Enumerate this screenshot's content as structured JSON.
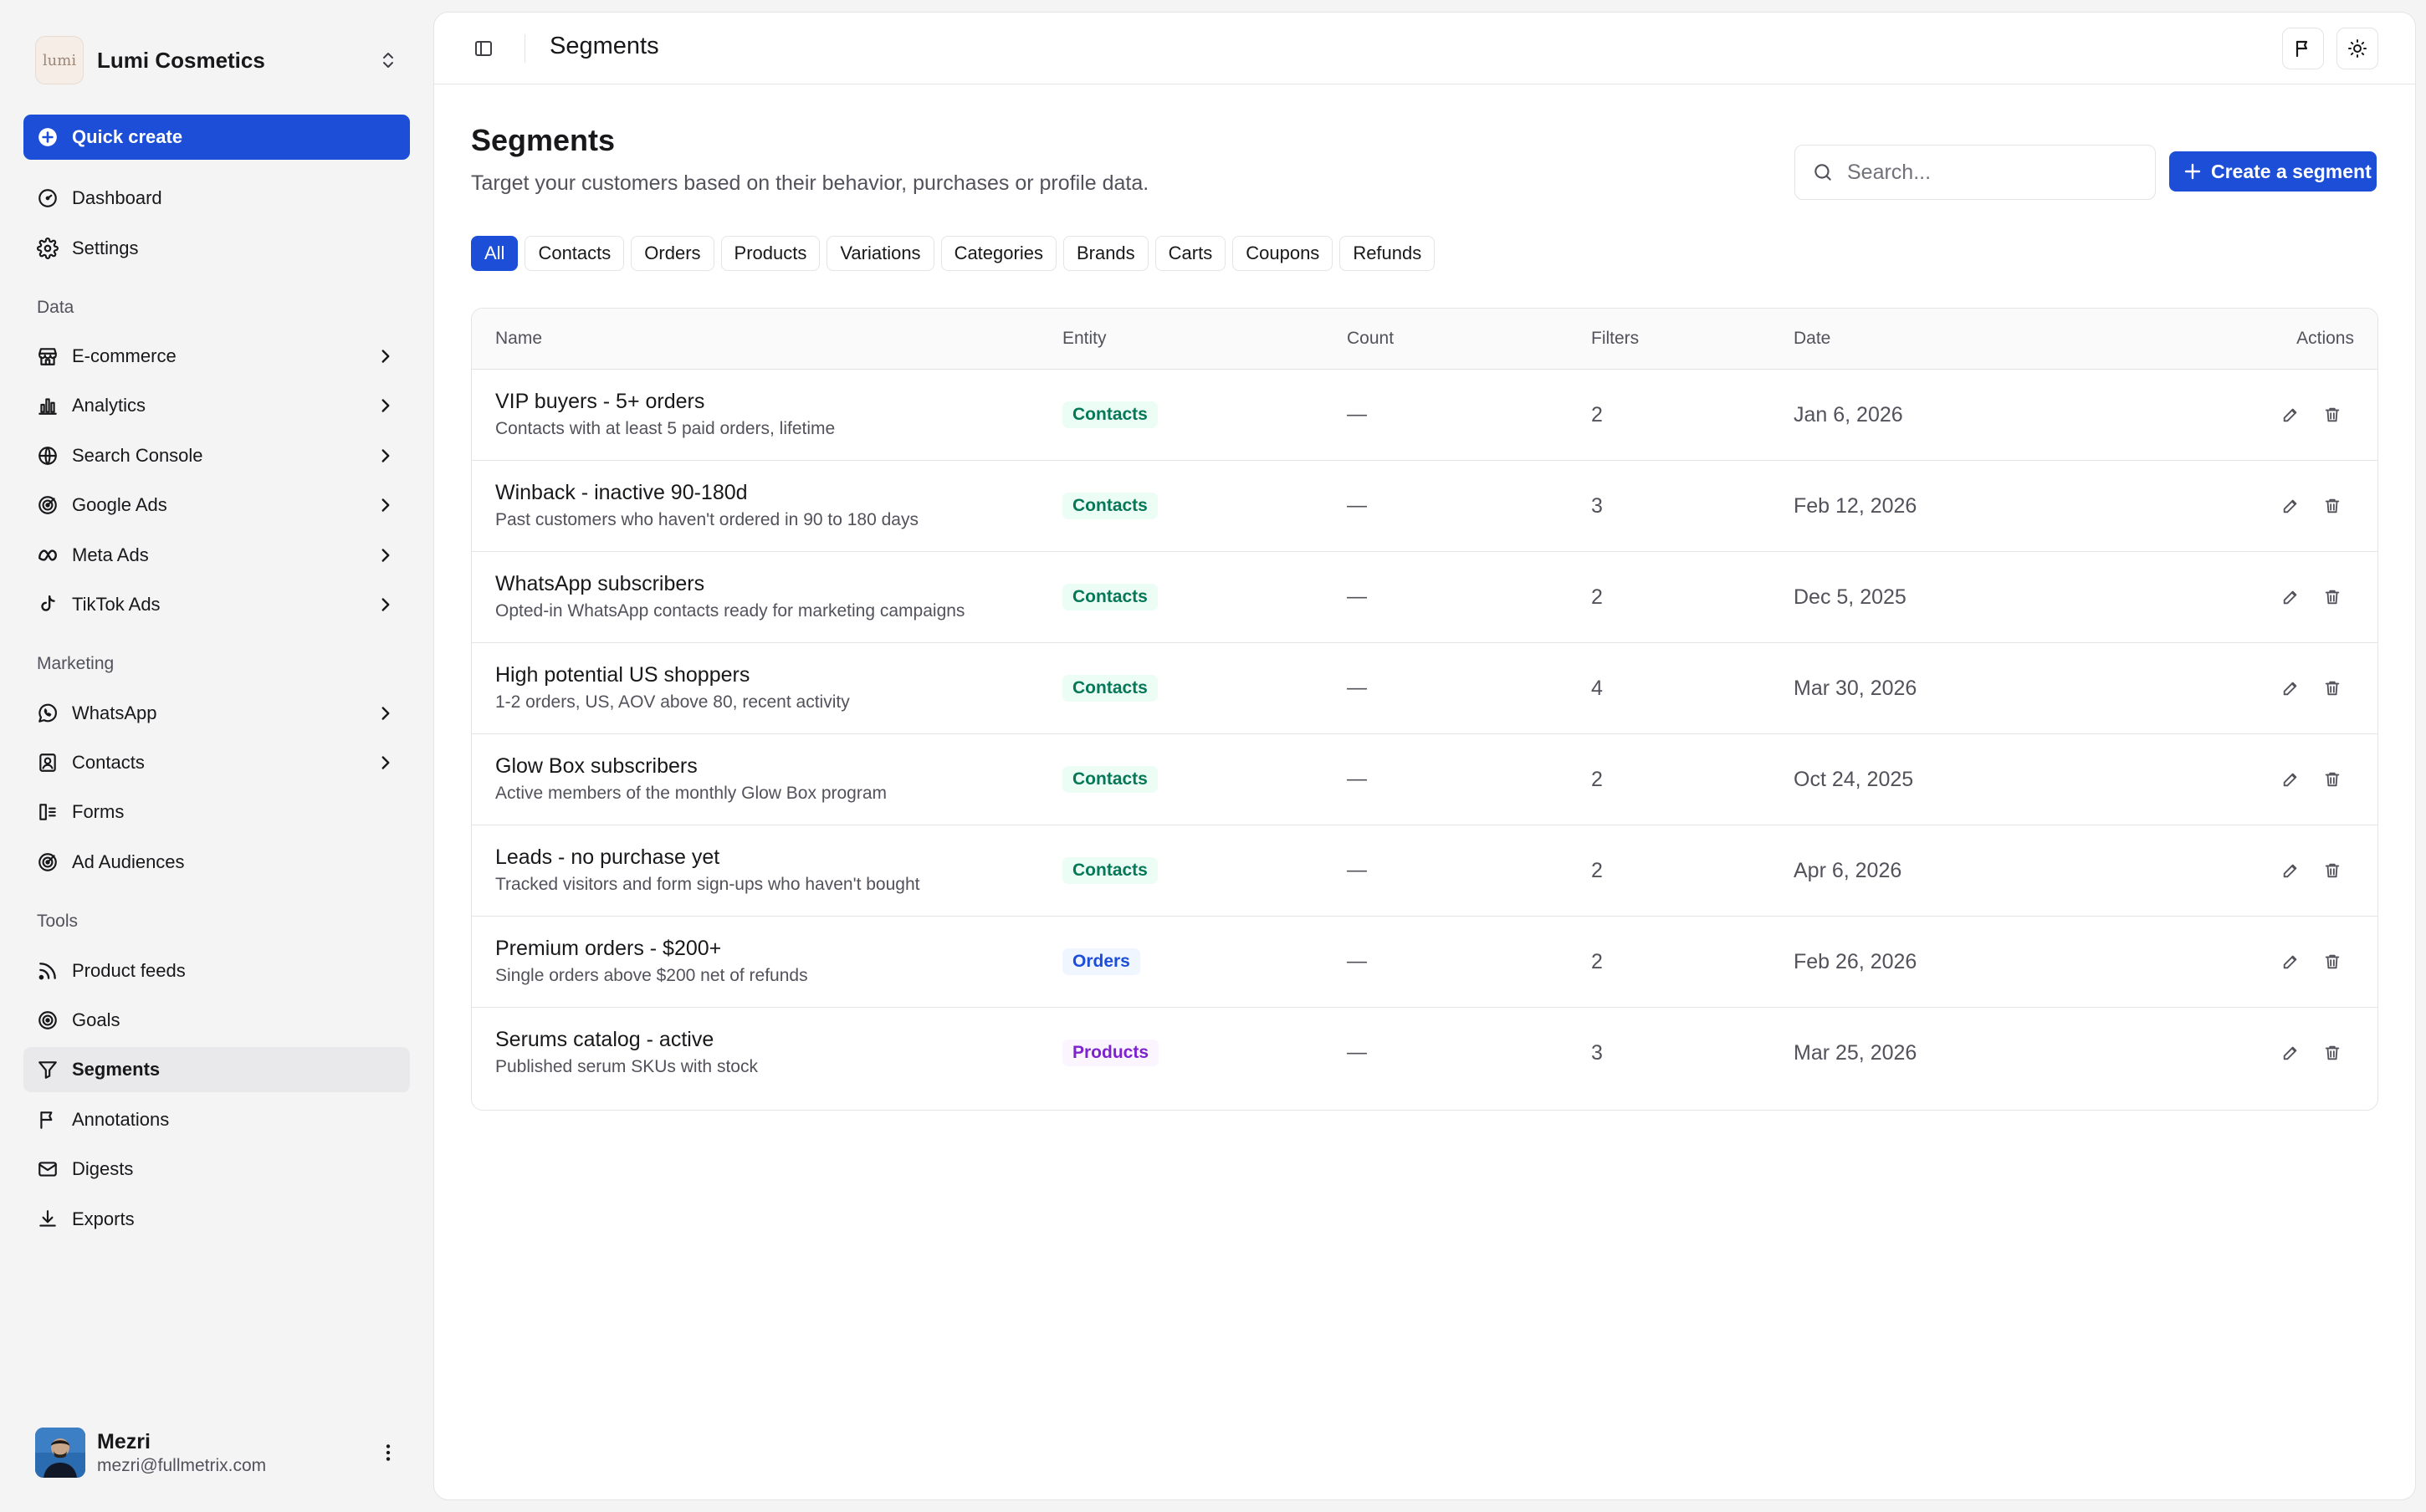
{
  "brand": {
    "logo_text": "lumi",
    "name": "Lumi Cosmetics"
  },
  "sidebar": {
    "quick_create": "Quick create",
    "top_items": [
      {
        "label": "Dashboard",
        "icon": "dashboard-icon"
      },
      {
        "label": "Settings",
        "icon": "gear-icon"
      }
    ],
    "sections": {
      "data": "Data",
      "marketing": "Marketing",
      "tools": "Tools"
    },
    "data_items": [
      {
        "label": "E-commerce",
        "icon": "store-icon"
      },
      {
        "label": "Analytics",
        "icon": "bar-chart-icon"
      },
      {
        "label": "Search Console",
        "icon": "search-console-icon"
      },
      {
        "label": "Google Ads",
        "icon": "google-ads-icon"
      },
      {
        "label": "Meta Ads",
        "icon": "meta-icon"
      },
      {
        "label": "TikTok Ads",
        "icon": "tiktok-icon"
      }
    ],
    "marketing_items": [
      {
        "label": "WhatsApp",
        "icon": "whatsapp-icon"
      },
      {
        "label": "Contacts",
        "icon": "contacts-icon"
      },
      {
        "label": "Forms",
        "icon": "forms-icon"
      },
      {
        "label": "Ad Audiences",
        "icon": "target-icon"
      }
    ],
    "tools_items": [
      {
        "label": "Product feeds",
        "icon": "rss-icon"
      },
      {
        "label": "Goals",
        "icon": "goal-icon"
      },
      {
        "label": "Segments",
        "icon": "filter-icon"
      },
      {
        "label": "Annotations",
        "icon": "flag-icon"
      },
      {
        "label": "Digests",
        "icon": "mail-icon"
      },
      {
        "label": "Exports",
        "icon": "download-icon"
      }
    ]
  },
  "user": {
    "name": "Mezri",
    "email": "mezri@fullmetrix.com"
  },
  "topbar": {
    "title": "Segments"
  },
  "page": {
    "title": "Segments",
    "subtitle": "Target your customers based on their behavior, purchases or profile data.",
    "search_placeholder": "Search...",
    "create_label": "Create a segment"
  },
  "tabs": [
    "All",
    "Contacts",
    "Orders",
    "Products",
    "Variations",
    "Categories",
    "Brands",
    "Carts",
    "Coupons",
    "Refunds"
  ],
  "table": {
    "headers": {
      "name": "Name",
      "entity": "Entity",
      "count": "Count",
      "filters": "Filters",
      "date": "Date",
      "actions": "Actions"
    },
    "rows": [
      {
        "title": "VIP buyers - 5+ orders",
        "desc": "Contacts with at least 5 paid orders, lifetime",
        "entity": "Contacts",
        "count": "—",
        "filters": "2",
        "date": "Jan 6, 2026"
      },
      {
        "title": "Winback - inactive 90-180d",
        "desc": "Past customers who haven't ordered in 90 to 180 days",
        "entity": "Contacts",
        "count": "—",
        "filters": "3",
        "date": "Feb 12, 2026"
      },
      {
        "title": "WhatsApp subscribers",
        "desc": "Opted-in WhatsApp contacts ready for marketing campaigns",
        "entity": "Contacts",
        "count": "—",
        "filters": "2",
        "date": "Dec 5, 2025"
      },
      {
        "title": "High potential US shoppers",
        "desc": "1-2 orders, US, AOV above 80, recent activity",
        "entity": "Contacts",
        "count": "—",
        "filters": "4",
        "date": "Mar 30, 2026"
      },
      {
        "title": "Glow Box subscribers",
        "desc": "Active members of the monthly Glow Box program",
        "entity": "Contacts",
        "count": "—",
        "filters": "2",
        "date": "Oct 24, 2025"
      },
      {
        "title": "Leads - no purchase yet",
        "desc": "Tracked visitors and form sign-ups who haven't bought",
        "entity": "Contacts",
        "count": "—",
        "filters": "2",
        "date": "Apr 6, 2026"
      },
      {
        "title": "Premium orders - $200+",
        "desc": "Single orders above $200 net of refunds",
        "entity": "Orders",
        "count": "—",
        "filters": "2",
        "date": "Feb 26, 2026"
      },
      {
        "title": "Serums catalog - active",
        "desc": "Published serum SKUs with stock",
        "entity": "Products",
        "count": "—",
        "filters": "3",
        "date": "Mar 25, 2026"
      }
    ]
  },
  "colors": {
    "accent": "#1d4ed8",
    "contacts_badge": "#047857",
    "orders_badge": "#1d4ed8",
    "products_badge": "#7e22ce"
  }
}
